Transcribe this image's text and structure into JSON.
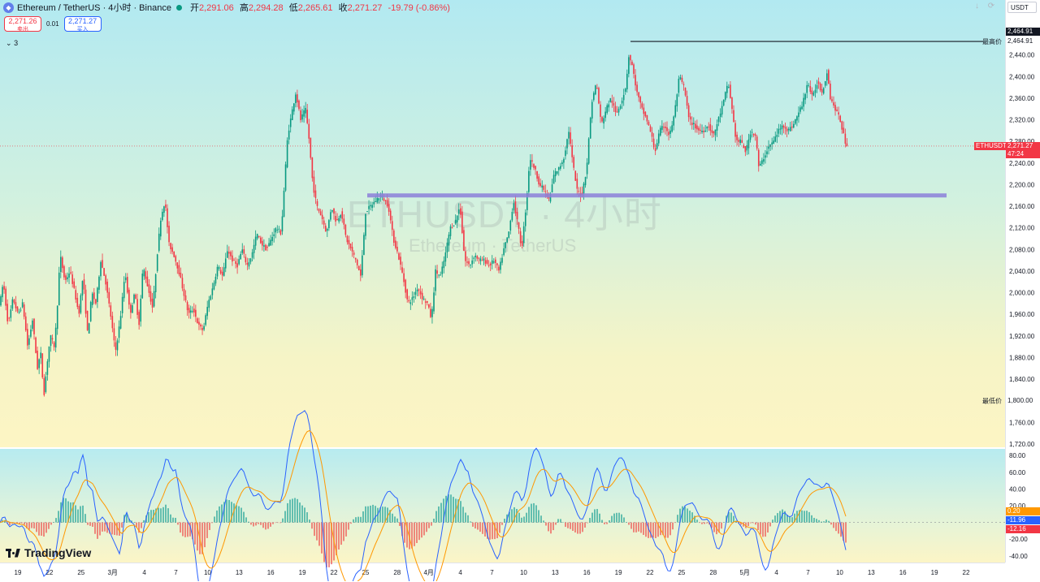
{
  "header": {
    "symbol_title": "Ethereum / TetherUS · 4小时 · Binance",
    "ohlc": [
      {
        "k": "开",
        "v": "2,291.06"
      },
      {
        "k": "高",
        "v": "2,294.28"
      },
      {
        "k": "低",
        "v": "2,265.61"
      },
      {
        "k": "收",
        "v": "2,271.27"
      }
    ],
    "change": "-19.79 (-0.86%)",
    "sell_price": "2,271.26",
    "sell_label": "卖出",
    "spread": "0.01",
    "buy_price": "2,271.27",
    "buy_label": "买入",
    "indicator_toggle": "3"
  },
  "currency_select": "USDT",
  "watermark": {
    "line1": "ETHUSDT · 4小时",
    "line2": "Ethereum · TetherUS"
  },
  "logo_text": "TradingView",
  "colors": {
    "up": "#089981",
    "down": "#f23645",
    "support_line": "#8c7fd9",
    "macd_line": "#2962ff",
    "signal_line": "#ff9800"
  },
  "chart_data": [
    {
      "type": "candlestick",
      "title": "",
      "symbol": "ETHUSDT",
      "ylim": [
        1720,
        2480
      ],
      "y_ticks": [
        "1,720.00",
        "1,760.00",
        "1,800.00",
        "1,840.00",
        "1,880.00",
        "1,920.00",
        "1,960.00",
        "2,000.00",
        "2,040.00",
        "2,080.00",
        "2,120.00",
        "2,160.00",
        "2,200.00",
        "2,240.00",
        "2,280.00",
        "2,320.00",
        "2,360.00",
        "2,400.00",
        "2,440.00"
      ],
      "x_ticks": [
        "19",
        "22",
        "25",
        "3月",
        "4",
        "7",
        "10",
        "13",
        "16",
        "19",
        "22",
        "25",
        "28",
        "4月",
        "4",
        "7",
        "10",
        "13",
        "16",
        "19",
        "22",
        "25",
        "28",
        "5月",
        "4",
        "7",
        "10",
        "13",
        "16",
        "19",
        "22"
      ],
      "highest": {
        "label": "最高价",
        "value": "2,464.91"
      },
      "lowest": {
        "label": "最低价",
        "value": "1,800.00"
      },
      "last_price": {
        "symbol": "ETHUSDT",
        "value": "2,271.27",
        "countdown": "47:24"
      },
      "support_level": 2180,
      "key_path": [
        [
          0,
          1980
        ],
        [
          4,
          2020
        ],
        [
          10,
          1940
        ],
        [
          16,
          1990
        ],
        [
          22,
          1960
        ],
        [
          28,
          1980
        ],
        [
          34,
          1900
        ],
        [
          40,
          1950
        ],
        [
          46,
          1860
        ],
        [
          50,
          1890
        ],
        [
          54,
          1810
        ],
        [
          58,
          1870
        ],
        [
          62,
          1920
        ],
        [
          67,
          1900
        ],
        [
          70,
          1960
        ],
        [
          74,
          2070
        ],
        [
          80,
          2020
        ],
        [
          86,
          2040
        ],
        [
          92,
          2000
        ],
        [
          97,
          1960
        ],
        [
          102,
          2030
        ],
        [
          108,
          1920
        ],
        [
          113,
          2000
        ],
        [
          118,
          1980
        ],
        [
          124,
          2060
        ],
        [
          130,
          2020
        ],
        [
          136,
          1960
        ],
        [
          142,
          1890
        ],
        [
          148,
          1950
        ],
        [
          154,
          2040
        ],
        [
          160,
          1960
        ],
        [
          166,
          2000
        ],
        [
          171,
          1940
        ],
        [
          176,
          2050
        ],
        [
          182,
          2010
        ],
        [
          188,
          1970
        ],
        [
          194,
          2080
        ],
        [
          198,
          2140
        ],
        [
          203,
          2170
        ],
        [
          208,
          2090
        ],
        [
          214,
          2070
        ],
        [
          220,
          2040
        ],
        [
          226,
          2000
        ],
        [
          232,
          1960
        ],
        [
          238,
          1970
        ],
        [
          244,
          1940
        ],
        [
          250,
          1930
        ],
        [
          256,
          1980
        ],
        [
          262,
          2010
        ],
        [
          268,
          2050
        ],
        [
          274,
          2030
        ],
        [
          280,
          2080
        ],
        [
          286,
          2060
        ],
        [
          292,
          2050
        ],
        [
          298,
          2080
        ],
        [
          304,
          2050
        ],
        [
          310,
          2070
        ],
        [
          316,
          2110
        ],
        [
          322,
          2090
        ],
        [
          328,
          2080
        ],
        [
          334,
          2100
        ],
        [
          340,
          2120
        ],
        [
          346,
          2110
        ],
        [
          350,
          2200
        ],
        [
          354,
          2290
        ],
        [
          360,
          2340
        ],
        [
          364,
          2370
        ],
        [
          370,
          2320
        ],
        [
          376,
          2340
        ],
        [
          380,
          2290
        ],
        [
          385,
          2200
        ],
        [
          390,
          2160
        ],
        [
          396,
          2140
        ],
        [
          402,
          2110
        ],
        [
          408,
          2160
        ],
        [
          414,
          2130
        ],
        [
          420,
          2150
        ],
        [
          426,
          2100
        ],
        [
          432,
          2080
        ],
        [
          438,
          2060
        ],
        [
          444,
          2030
        ],
        [
          450,
          2150
        ],
        [
          456,
          2160
        ],
        [
          462,
          2170
        ],
        [
          468,
          2180
        ],
        [
          474,
          2170
        ],
        [
          478,
          2160
        ],
        [
          484,
          2100
        ],
        [
          490,
          2070
        ],
        [
          496,
          2030
        ],
        [
          502,
          1980
        ],
        [
          508,
          1990
        ],
        [
          514,
          2010
        ],
        [
          520,
          1990
        ],
        [
          526,
          1980
        ],
        [
          531,
          1950
        ],
        [
          536,
          2040
        ],
        [
          542,
          2030
        ],
        [
          548,
          2070
        ],
        [
          554,
          2120
        ],
        [
          560,
          2130
        ],
        [
          566,
          2160
        ],
        [
          572,
          2060
        ],
        [
          578,
          2050
        ],
        [
          584,
          2070
        ],
        [
          590,
          2060
        ],
        [
          596,
          2060
        ],
        [
          602,
          2050
        ],
        [
          608,
          2060
        ],
        [
          614,
          2040
        ],
        [
          620,
          2080
        ],
        [
          626,
          2110
        ],
        [
          632,
          2170
        ],
        [
          638,
          2120
        ],
        [
          642,
          2080
        ],
        [
          648,
          2170
        ],
        [
          652,
          2250
        ],
        [
          658,
          2230
        ],
        [
          664,
          2200
        ],
        [
          670,
          2190
        ],
        [
          676,
          2170
        ],
        [
          682,
          2220
        ],
        [
          688,
          2230
        ],
        [
          694,
          2250
        ],
        [
          700,
          2300
        ],
        [
          704,
          2250
        ],
        [
          710,
          2190
        ],
        [
          716,
          2180
        ],
        [
          722,
          2230
        ],
        [
          728,
          2350
        ],
        [
          734,
          2390
        ],
        [
          740,
          2310
        ],
        [
          746,
          2340
        ],
        [
          752,
          2360
        ],
        [
          758,
          2330
        ],
        [
          764,
          2350
        ],
        [
          770,
          2380
        ],
        [
          774,
          2440
        ],
        [
          778,
          2420
        ],
        [
          784,
          2370
        ],
        [
          790,
          2340
        ],
        [
          796,
          2320
        ],
        [
          802,
          2290
        ],
        [
          806,
          2260
        ],
        [
          812,
          2300
        ],
        [
          818,
          2310
        ],
        [
          824,
          2290
        ],
        [
          830,
          2330
        ],
        [
          836,
          2400
        ],
        [
          842,
          2380
        ],
        [
          848,
          2320
        ],
        [
          854,
          2310
        ],
        [
          860,
          2300
        ],
        [
          866,
          2300
        ],
        [
          872,
          2310
        ],
        [
          878,
          2290
        ],
        [
          884,
          2320
        ],
        [
          890,
          2350
        ],
        [
          896,
          2390
        ],
        [
          900,
          2350
        ],
        [
          906,
          2280
        ],
        [
          912,
          2280
        ],
        [
          918,
          2260
        ],
        [
          924,
          2300
        ],
        [
          930,
          2290
        ],
        [
          934,
          2230
        ],
        [
          940,
          2250
        ],
        [
          946,
          2270
        ],
        [
          952,
          2280
        ],
        [
          958,
          2300
        ],
        [
          964,
          2310
        ],
        [
          970,
          2300
        ],
        [
          976,
          2310
        ],
        [
          982,
          2330
        ],
        [
          988,
          2350
        ],
        [
          994,
          2390
        ],
        [
          1000,
          2360
        ],
        [
          1006,
          2390
        ],
        [
          1012,
          2370
        ],
        [
          1018,
          2410
        ],
        [
          1022,
          2360
        ],
        [
          1028,
          2340
        ],
        [
          1034,
          2320
        ],
        [
          1040,
          2280
        ],
        [
          1043,
          2271
        ]
      ]
    },
    {
      "type": "line",
      "title": "",
      "ylim": [
        -45,
        85
      ],
      "y_ticks": [
        "80.00",
        "60.00",
        "40.00",
        "20.00",
        "-20.00",
        "-40.00"
      ],
      "last_values": [
        {
          "value": "0.20",
          "color": "#ff9800"
        },
        {
          "value": "-11.96",
          "color": "#2962ff"
        },
        {
          "value": "-12.16",
          "color": "#f23645"
        }
      ]
    }
  ]
}
